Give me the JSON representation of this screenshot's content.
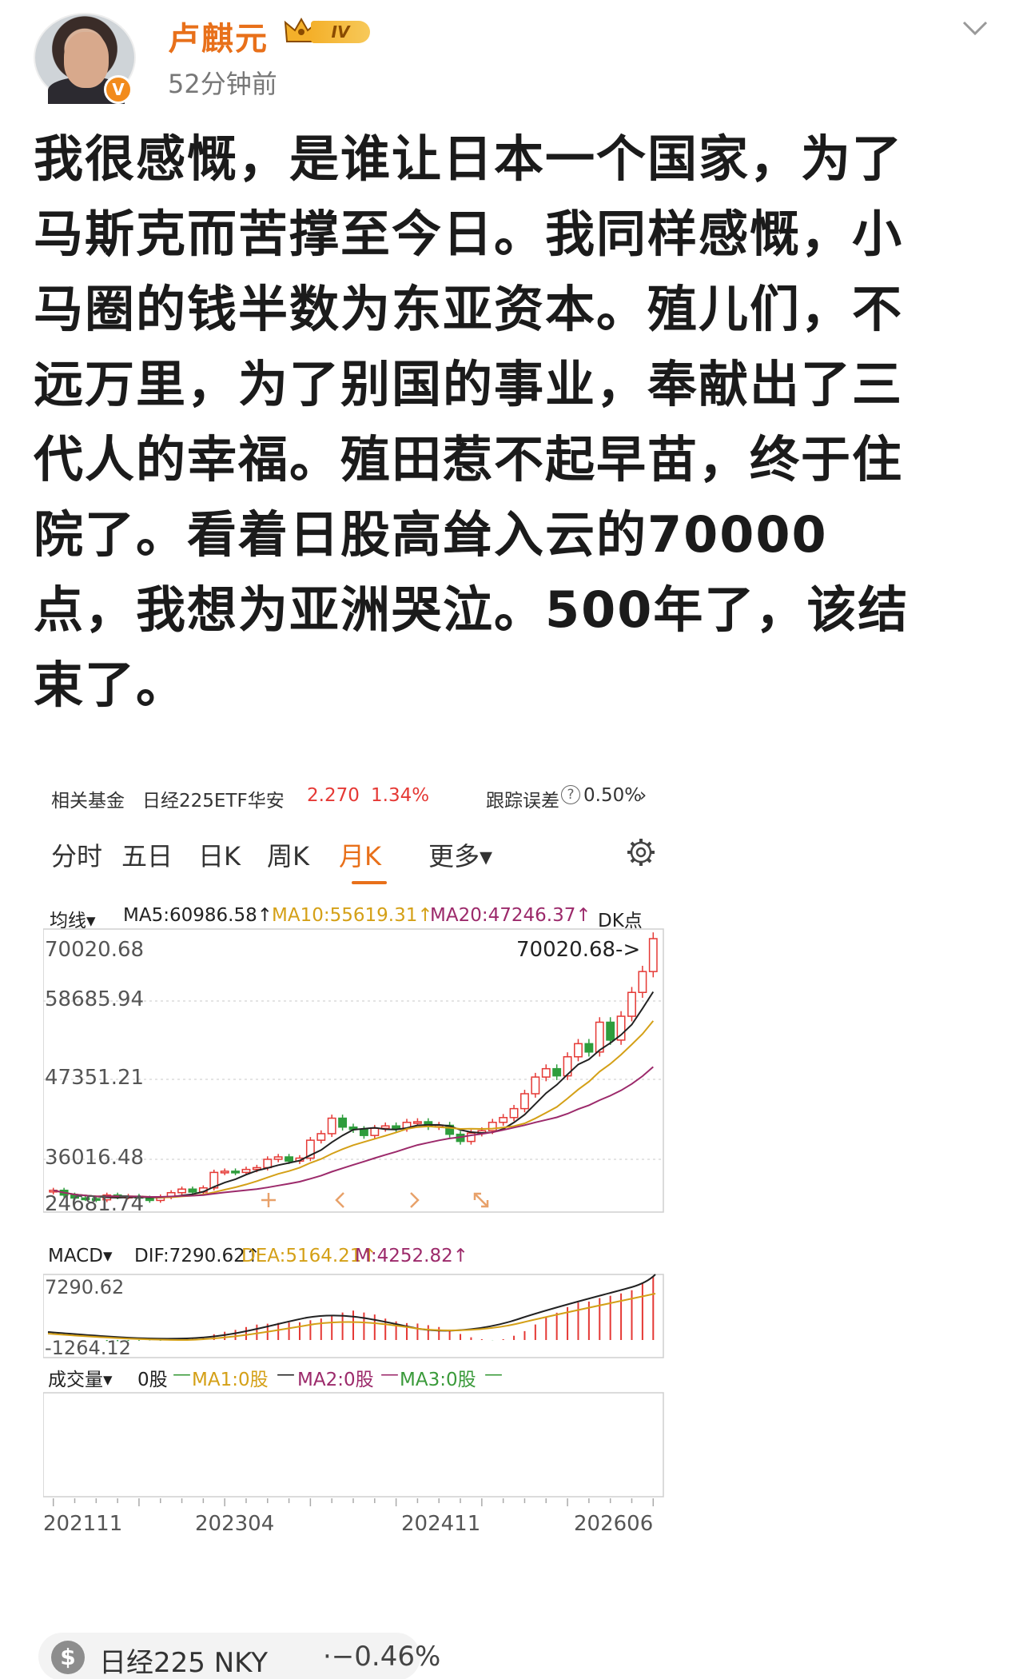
{
  "author": {
    "name": "卢麒元",
    "vip_level": "IV",
    "time": "52分钟前",
    "verified_mark": "V"
  },
  "post": {
    "lines": [
      "我很感慨，是谁让日本一个国家，为了",
      "马斯克而苦撑至今日。我同样感慨，小",
      "马圈的钱半数为东亚资本。殖儿们，不",
      "远万里，为了别国的事业，奉献出了三",
      "代人的幸福。殖田惹不起早苗，终于住",
      "院了。看着日股高耸入云的70000",
      "点，我想为亚洲哭泣。500年了，该结",
      "束了。"
    ]
  },
  "fund": {
    "label": "相关基金",
    "name": "日经225ETF华安",
    "price": "2.270",
    "change": "1.34%",
    "tracking_label": "跟踪误差",
    "tracking_value": "0.50%",
    "help_glyph": "?"
  },
  "tabs": [
    {
      "label": "分时"
    },
    {
      "label": "五日"
    },
    {
      "label": "日K"
    },
    {
      "label": "周K"
    },
    {
      "label": "月K"
    },
    {
      "label": "更多▾"
    }
  ],
  "ma": {
    "title": "均线▾",
    "ma5": "MA5:60986.58↑",
    "ma10": "MA10:55619.31↑",
    "ma20": "MA20:47246.37↑",
    "dk": "DK点"
  },
  "chart_data": [
    {
      "type": "candlestick",
      "title": "",
      "y_ticks": [
        "70020.68",
        "58685.94",
        "47351.21",
        "36016.48",
        "24681.74"
      ],
      "ylim": [
        24681.74,
        70020.68
      ],
      "x_ticks": [
        "202111",
        "202304",
        "202411",
        "202606"
      ],
      "annotations": [
        "70020.68->",
        "24681.74"
      ],
      "series": [
        {
          "name": "MA5",
          "color": "#222222"
        },
        {
          "name": "MA10",
          "color": "#d4a017"
        },
        {
          "name": "MA20",
          "color": "#9c2a6b"
        }
      ],
      "close_series": [
        27800,
        27000,
        26500,
        26400,
        26200,
        27000,
        26700,
        26800,
        26500,
        26100,
        26700,
        27400,
        28000,
        27500,
        28200,
        30800,
        31000,
        30800,
        31300,
        31600,
        33000,
        33400,
        32700,
        33200,
        36200,
        37300,
        39900,
        38400,
        38000,
        37000,
        38200,
        38600,
        38200,
        39200,
        39300,
        38500,
        38700,
        37200,
        36000,
        37400,
        37800,
        39200,
        40000,
        41500,
        44000,
        46800,
        48200,
        47000,
        50200,
        52400,
        51000,
        56000,
        53000,
        57000,
        61000,
        64500,
        70020
      ]
    },
    {
      "type": "bar",
      "title": "MACD",
      "dif": "DIF:7290.62↑",
      "dea": "DEA:5164.21↑",
      "m": "M:4252.82↑",
      "y_ticks": [
        "7290.62",
        "-1264.12"
      ],
      "ylim": [
        -1264.12,
        7290.62
      ]
    }
  ],
  "macd_labels": {
    "title": "MACD▾",
    "dif": "DIF:7290.62↑",
    "dea": "DEA:5164.21↑",
    "m": "M:4252.82↑",
    "top_tick": "7290.62",
    "bottom_tick": "-1264.12"
  },
  "price_labels": {
    "top": "70020.68",
    "t2": "58685.94",
    "t3": "47351.21",
    "t4": "36016.48",
    "bottom": "24681.74",
    "high_annot": "70020.68->"
  },
  "volume": {
    "title": "成交量▾",
    "value": "0股",
    "ma1": "MA1:0股",
    "ma2": "MA2:0股",
    "ma3": "MA3:0股",
    "dash": "—"
  },
  "x_axis": [
    "202111",
    "202304",
    "202411",
    "202606"
  ],
  "ticker": {
    "coin": "$",
    "name": "日经225 NKY",
    "change": "·−0.46%"
  },
  "colors": {
    "up": "#e53935",
    "down": "#2e9d3c",
    "accent": "#e8701a"
  }
}
